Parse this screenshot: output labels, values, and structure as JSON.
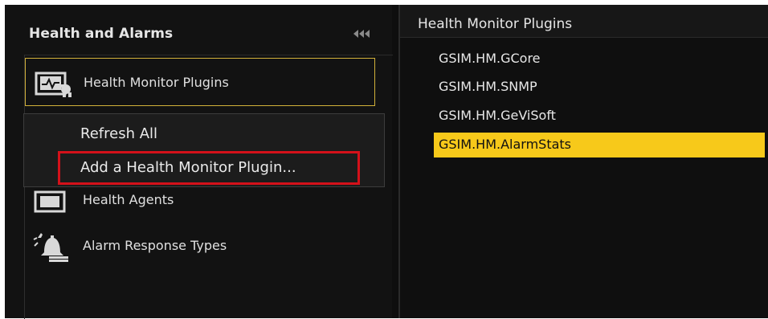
{
  "left_panel": {
    "title": "Health and Alarms",
    "nav_items": [
      {
        "label": "Health Monitor Plugins",
        "icon": "health-plugin-icon"
      },
      {
        "label": "Health Agents",
        "icon": "health-agents-icon"
      },
      {
        "label": "Alarm Response Types",
        "icon": "alarm-bell-icon"
      }
    ]
  },
  "context_menu": {
    "items": [
      {
        "label": "Refresh All"
      },
      {
        "label": "Add a Health Monitor Plugin..."
      }
    ]
  },
  "right_panel": {
    "title": "Health Monitor Plugins",
    "plugins": [
      {
        "label": "GSIM.HM.GCore"
      },
      {
        "label": "GSIM.HM.SNMP"
      },
      {
        "label": "GSIM.HM.GeViSoft"
      },
      {
        "label": "GSIM.HM.AlarmStats"
      }
    ],
    "selected_index": 3
  },
  "colors": {
    "selection": "#f7c91a",
    "outline_highlight": "#d4111a",
    "nav_selected_border": "#d2b13a"
  }
}
